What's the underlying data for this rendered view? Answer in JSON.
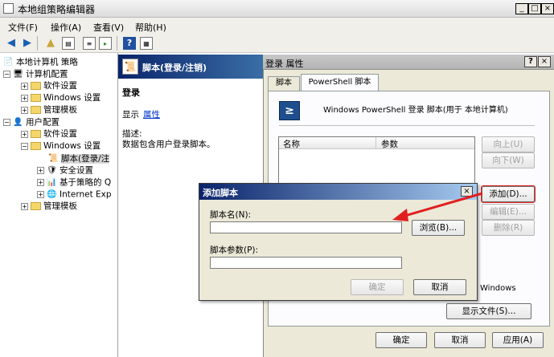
{
  "window": {
    "title": "本地组策略编辑器",
    "min": "_",
    "max": "□",
    "close": "×"
  },
  "menu": [
    "文件(F)",
    "操作(A)",
    "查看(V)",
    "帮助(H)"
  ],
  "toolbar_icons": [
    "back-icon",
    "forward-icon",
    "up-folder-icon",
    "show-tree-icon",
    "export-icon",
    "properties-icon",
    "help-icon",
    "console-icon"
  ],
  "tree": {
    "root": "本地计算机 策略",
    "computer": "计算机配置",
    "c_software": "软件设置",
    "c_windows": "Windows 设置",
    "c_admin": "管理模板",
    "user": "用户配置",
    "u_software": "软件设置",
    "u_windows": "Windows 设置",
    "scripts": "脚本(登录/注",
    "security": "安全设置",
    "policy_qos": "基于策略的 Q",
    "ie": "Internet Exp",
    "u_admin": "管理模板"
  },
  "middle": {
    "header": "脚本(登录/注销)",
    "section": "登录",
    "show": "显示",
    "properties_link": "属性",
    "desc_label": "描述:",
    "desc_text": "数据包含用户登录脚本。"
  },
  "props": {
    "title": "登录 属性",
    "help": "?",
    "close": "×",
    "tabs": [
      "脚本",
      "PowerShell 脚本"
    ],
    "heading": "Windows PowerShell 登录 脚本(用于 本地计算机)",
    "col_name": "名称",
    "col_params": "参数",
    "btn_up": "向上(U)",
    "btn_down": "向下(W)",
    "btn_add": "添加(D)...",
    "btn_edit": "编辑(E)...",
    "btn_remove": "删除(R)",
    "windows_partial": "Windows",
    "btn_show_files": "显示文件(S)...",
    "btn_ok": "确定",
    "btn_cancel": "取消",
    "btn_apply": "应用(A)"
  },
  "dialog": {
    "title": "添加脚本",
    "close": "×",
    "script_name_label": "脚本名(N):",
    "script_name_value": "",
    "browse": "浏览(B)...",
    "params_label": "脚本参数(P):",
    "params_value": "",
    "ok": "确定",
    "cancel": "取消"
  },
  "colors": {
    "accent": "#0a246a",
    "annotation": "#e02020"
  }
}
